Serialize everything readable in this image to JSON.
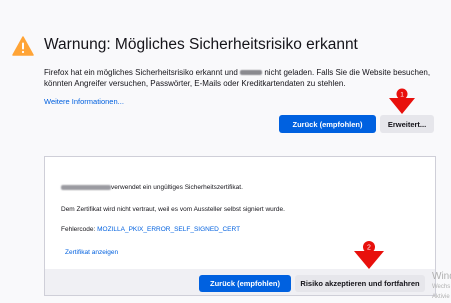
{
  "header": {
    "title": "Warnung: Mögliches Sicherheitsrisiko erkannt",
    "desc_part1": "Firefox hat ein mögliches Sicherheitsrisiko erkannt und",
    "desc_part2": "nicht geladen. Falls Sie die Website besuchen, könnten Angreifer versuchen, Passwörter, E-Mails oder Kreditkartendaten zu stehlen.",
    "more_info_link": "Weitere Informationen..."
  },
  "buttons": {
    "back_label": "Zurück (empfohlen)",
    "advanced_label": "Erweitert...",
    "accept_label": "Risiko akzeptieren und fortfahren"
  },
  "advanced_panel": {
    "cert_invalid": "verwendet ein ungültiges Sicherheitszertifikat.",
    "not_trusted": "Dem Zertifikat wird nicht vertraut, weil es vom Aussteller selbst signiert wurde.",
    "error_code_label": "Fehlercode:",
    "error_code": "MOZILLA_PKIX_ERROR_SELF_SIGNED_CERT",
    "view_cert_link": "Zertifikat anzeigen"
  },
  "annotations": {
    "marker_1": "1",
    "marker_2": "2",
    "marker_color": "#e8100c"
  },
  "watermark": {
    "line1": "Wind",
    "line2": "Wechs",
    "line3": "Aktivie"
  },
  "colors": {
    "accent": "#0061e0",
    "link": "#0060df",
    "warning": "#ffa436"
  }
}
